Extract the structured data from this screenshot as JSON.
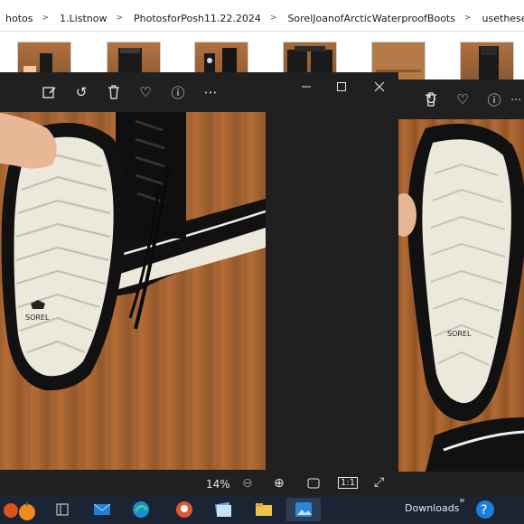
{
  "breadcrumb": [
    "hotos",
    "1.Listnow",
    "PhotosforPosh11.22.2024",
    "SorelJoanofArcticWaterproofBoots",
    "usethese"
  ],
  "thumbnails": [
    "boot-photo-1",
    "boot-photo-2",
    "boot-photo-3",
    "boot-photo-4",
    "boot-photo-5",
    "boot-photo-6"
  ],
  "viewer": {
    "toolbar": [
      "edit-icon",
      "rotate-icon",
      "delete-icon",
      "favorite-icon",
      "info-icon",
      "more-icon"
    ],
    "window_controls": [
      "minimize-icon",
      "maximize-icon",
      "close-icon"
    ],
    "zoom_level": "14%",
    "actual_size_label": "1:1"
  },
  "viewer2": {
    "toolbar": [
      "delete-icon",
      "favorite-icon",
      "info-icon",
      "more-icon"
    ]
  },
  "taskbar": {
    "downloads_label": "Downloads",
    "overflow_label": "»"
  },
  "colors": {
    "explorer_bg": "#ffffff",
    "viewer_bg": "#202020",
    "taskbar_bg": "#1a2433",
    "accent": "#0078d4",
    "floor": "#a0602e",
    "sole": "#ece8dc"
  }
}
